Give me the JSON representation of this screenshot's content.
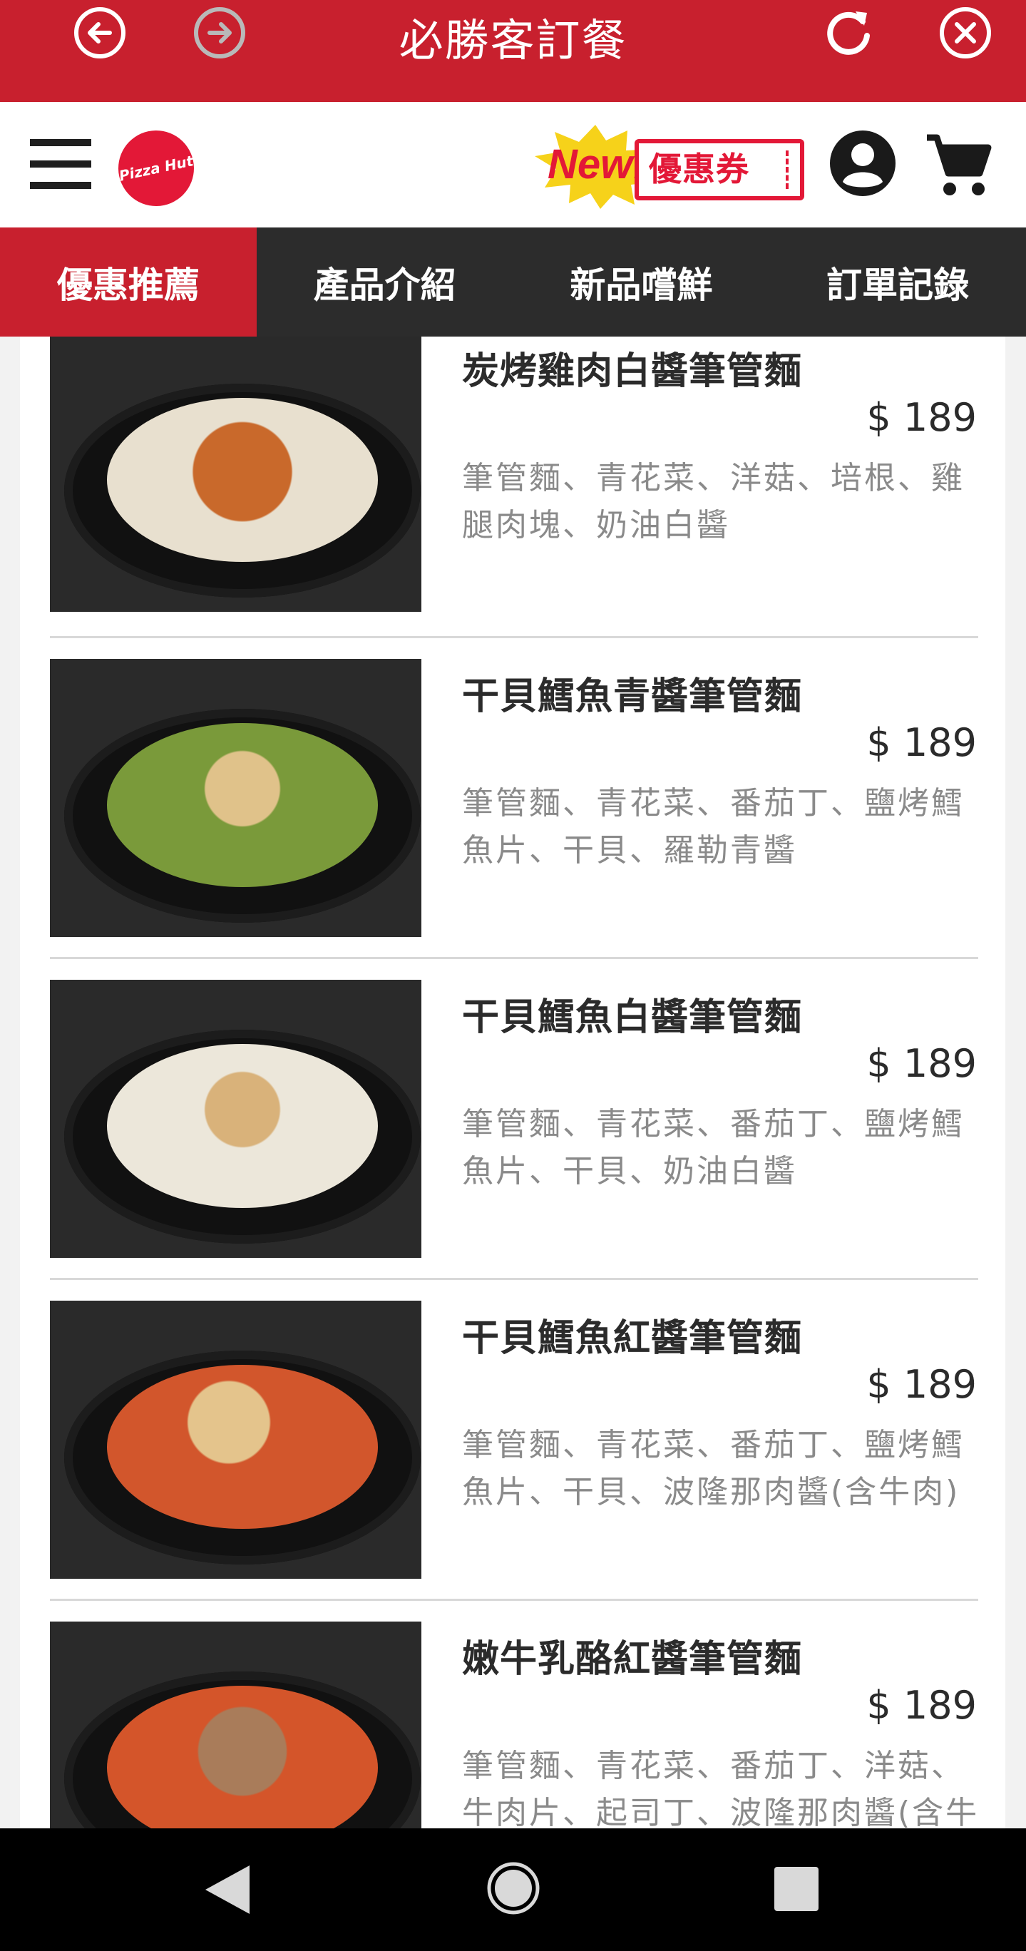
{
  "titlebar": {
    "title": "必勝客訂餐",
    "back_icon": "arrow-left-circle",
    "forward_icon": "arrow-right-circle",
    "refresh_icon": "refresh",
    "close_icon": "close-circle"
  },
  "header": {
    "logo_text": "Pizza Hut",
    "coupon_new": "New!",
    "coupon_label": "優惠券"
  },
  "tabs": [
    {
      "label": "優惠推薦",
      "active": true
    },
    {
      "label": "產品介紹",
      "active": false
    },
    {
      "label": "新品嚐鮮",
      "active": false
    },
    {
      "label": "訂單記錄",
      "active": false
    }
  ],
  "products": [
    {
      "name": "炭烤雞肉白醬筆管麵",
      "price": "$ 189",
      "desc": "筆管麵、青花菜、洋菇、培根、雞腿肉塊、奶油白醬",
      "sauce_color": "#e8e0cf",
      "topping_color": "#c9692b"
    },
    {
      "name": "干貝鱈魚青醬筆管麵",
      "price": "$ 189",
      "desc": "筆管麵、青花菜、番茄丁、鹽烤鱈魚片、干貝、羅勒青醬",
      "sauce_color": "#7a9a3a",
      "topping_color": "#e0c28a"
    },
    {
      "name": "干貝鱈魚白醬筆管麵",
      "price": "$ 189",
      "desc": "筆管麵、青花菜、番茄丁、鹽烤鱈魚片、干貝、奶油白醬",
      "sauce_color": "#ece7da",
      "topping_color": "#d9b27a"
    },
    {
      "name": "干貝鱈魚紅醬筆管麵",
      "price": "$ 189",
      "desc": "筆管麵、青花菜、番茄丁、鹽烤鱈魚片、干貝、波隆那肉醬(含牛肉)",
      "sauce_color": "#d2562c",
      "topping_color": "#e4c48c"
    },
    {
      "name": "嫩牛乳酪紅醬筆管麵",
      "price": "$ 189",
      "desc": "筆管麵、青花菜、番茄丁、洋菇、牛肉片、起司丁、波隆那肉醬(含牛肉)",
      "sauce_color": "#d4552a",
      "topping_color": "#a97c5a"
    }
  ],
  "colors": {
    "brand_red": "#c8202e",
    "tab_dark": "#2c2c2c"
  }
}
